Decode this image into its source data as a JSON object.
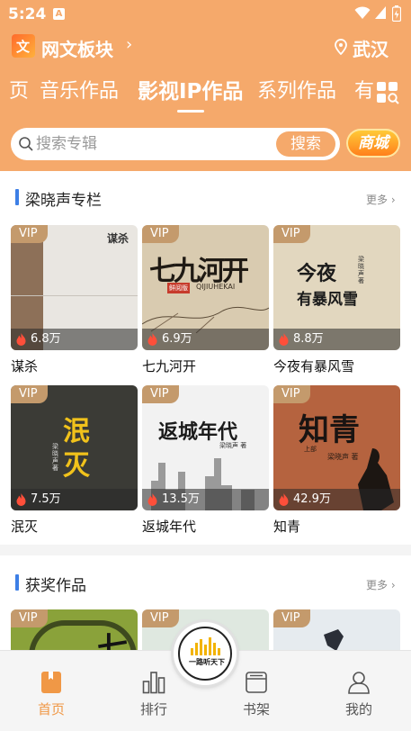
{
  "status_bar": {
    "time": "5:24",
    "a_badge": "A"
  },
  "app_bar": {
    "title": "网文板块",
    "location": "武汉"
  },
  "tabs": [
    {
      "label": "页"
    },
    {
      "label": "音乐作品"
    },
    {
      "label": "影视IP作品",
      "active": true
    },
    {
      "label": "系列作品"
    },
    {
      "label": "有"
    }
  ],
  "search": {
    "placeholder": "搜索专辑",
    "button_label": "搜索"
  },
  "shop_button": "商城",
  "sections": [
    {
      "title": "梁晓声专栏",
      "more": "更多",
      "books": [
        {
          "title": "谋杀",
          "badge": "VIP",
          "heat": "6.8万",
          "cover_text": "谋杀"
        },
        {
          "title": "七九河开",
          "badge": "VIP",
          "heat": "6.9万",
          "cover_text": "七九河开",
          "cover_subtext": "QIJIUHEKAI",
          "cover_tag": "鲜阅版"
        },
        {
          "title": "今夜有暴风雪",
          "badge": "VIP",
          "heat": "8.8万",
          "cover_text": "今夜",
          "cover_text2": "有暴风雪",
          "cover_author": "梁晓声 著"
        },
        {
          "title": "泯灭",
          "badge": "VIP",
          "heat": "7.5万",
          "cover_text": "泯",
          "cover_text2": "灭",
          "cover_author": "梁晓声 著"
        },
        {
          "title": "返城年代",
          "badge": "VIP",
          "heat": "13.5万",
          "cover_text": "返城年代",
          "cover_author": "梁晓声 著"
        },
        {
          "title": "知青",
          "badge": "VIP",
          "heat": "42.9万",
          "cover_text": "知青",
          "cover_sub": "上部",
          "cover_author": "梁晓声 著"
        }
      ]
    },
    {
      "title": "获奖作品",
      "more": "更多",
      "books": [
        {
          "badge": "VIP",
          "cover_text": "七"
        },
        {
          "badge": "VIP"
        },
        {
          "badge": "VIP"
        }
      ]
    }
  ],
  "bottom_nav": [
    {
      "label": "首页",
      "icon": "home-book-icon",
      "active": true
    },
    {
      "label": "排行",
      "icon": "ranking-bars-icon"
    },
    {
      "label": "书架",
      "icon": "bookshelf-icon"
    },
    {
      "label": "我的",
      "icon": "user-profile-icon"
    }
  ],
  "center_logo_text": "一路听天下",
  "colors": {
    "header": "#f5a96b",
    "accent_blue": "#3d7fe6",
    "vip": "#c49a6c",
    "nav_active": "#f09846"
  }
}
